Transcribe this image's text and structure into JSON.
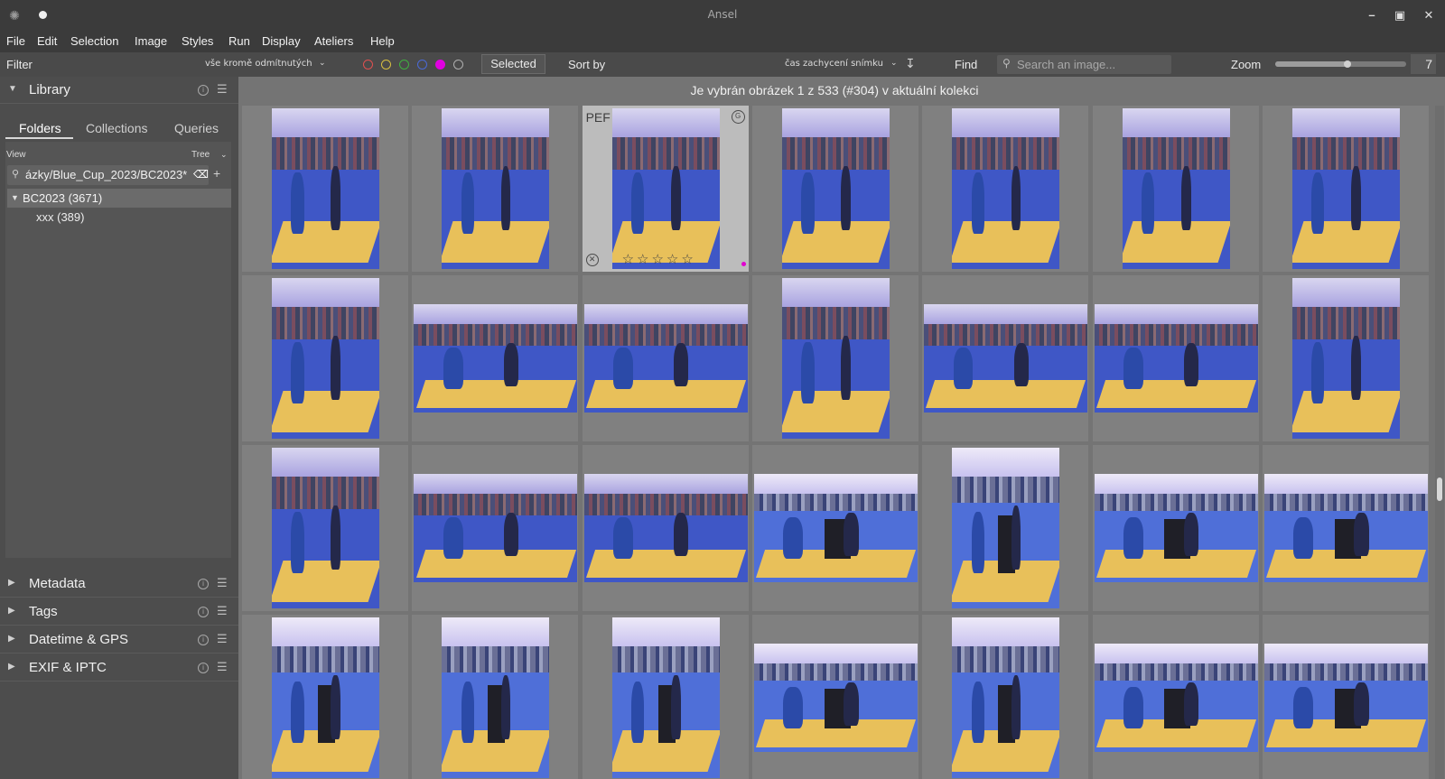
{
  "window": {
    "title": "Ansel"
  },
  "menu": [
    "File",
    "Edit",
    "Selection",
    "Image",
    "Styles",
    "Run",
    "Display",
    "Ateliers",
    "Help"
  ],
  "filterbar": {
    "filter_label": "Filter",
    "filter_value": "vše kromě odmítnutých",
    "color_labels": [
      {
        "name": "red",
        "color": "#e05050",
        "filled": false
      },
      {
        "name": "yellow",
        "color": "#d8c040",
        "filled": false
      },
      {
        "name": "green",
        "color": "#40b040",
        "filled": false
      },
      {
        "name": "blue",
        "color": "#4a6ad8",
        "filled": false
      },
      {
        "name": "purple",
        "color": "#e000e0",
        "filled": true
      },
      {
        "name": "gray",
        "color": "#b0b0b0",
        "filled": false
      }
    ],
    "selected_button": "Selected",
    "sort_label": "Sort by",
    "sort_value": "čas zachycení snímku",
    "find_label": "Find",
    "search_placeholder": "Search an image...",
    "zoom_label": "Zoom",
    "zoom_value": "7",
    "zoom_level": 0.55
  },
  "library": {
    "title": "Library",
    "tabs": [
      "Folders",
      "Collections",
      "Queries"
    ],
    "active_tab": "Folders",
    "view_label": "View",
    "view_mode": "Tree",
    "path": "ázky/Blue_Cup_2023/BC2023*",
    "tree_root": "BC2023 (3671)",
    "tree_child": "xxx (389)"
  },
  "collapsed_panels": [
    "Metadata",
    "Tags",
    "Datetime & GPS",
    "EXIF & IPTC"
  ],
  "main": {
    "info": "Je vybrán obrázek 1 z 533 (#304) v aktuální kolekci",
    "active_thumb": {
      "format": "PEF",
      "stars": "☆☆☆☆☆"
    }
  },
  "grid": {
    "columns": 7,
    "rows": [
      [
        "portrait",
        "portrait",
        "portrait-active",
        "portrait",
        "portrait",
        "portrait",
        "portrait"
      ],
      [
        "portrait",
        "landscape",
        "landscape",
        "portrait",
        "landscape",
        "landscape",
        "portrait"
      ],
      [
        "portrait",
        "landscape",
        "landscape",
        "landscape-bright",
        "portrait-bright",
        "landscape-bright",
        "landscape-bright"
      ],
      [
        "portrait-bright",
        "portrait-bright",
        "portrait-bright",
        "landscape-bright",
        "portrait-bright",
        "landscape-bright",
        "landscape-bright"
      ]
    ]
  }
}
